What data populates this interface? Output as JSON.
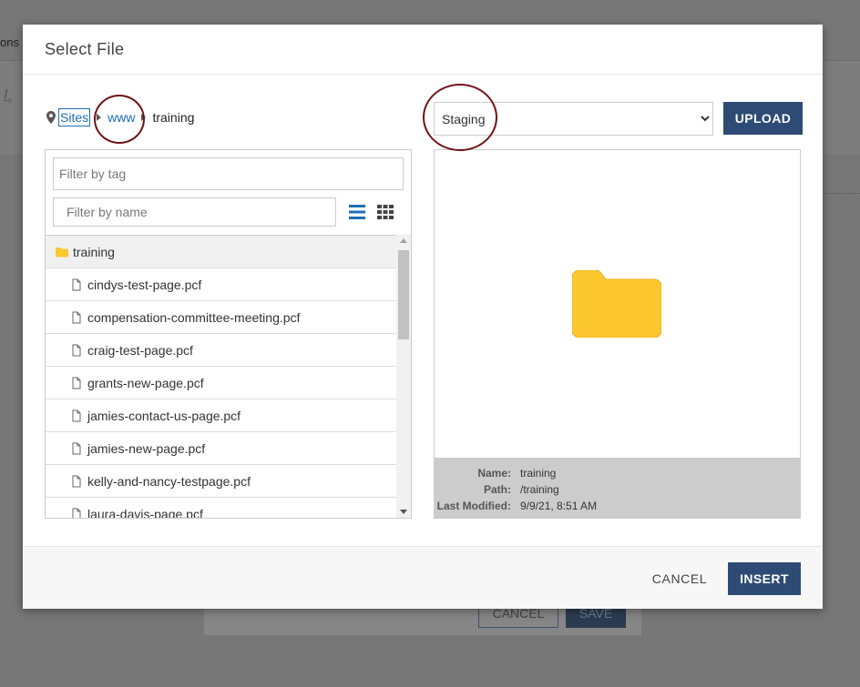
{
  "background": {
    "partial_text": "ons",
    "format_icon": "clear-formatting-icon",
    "dialog_cancel_label": "CANCEL",
    "dialog_save_label": "SAVE"
  },
  "modal": {
    "title": "Select File",
    "breadcrumb": {
      "icon": "map-marker-icon",
      "items": [
        {
          "label": "Sites"
        },
        {
          "label": "www"
        },
        {
          "label": "training"
        }
      ]
    },
    "filters": {
      "tag_placeholder": "Filter by tag",
      "name_placeholder": "Filter by name"
    },
    "view_toggles": [
      "list-view-icon",
      "grid-view-icon"
    ],
    "file_list": [
      {
        "type": "folder",
        "name": "training"
      },
      {
        "type": "file",
        "name": "cindys-test-page.pcf"
      },
      {
        "type": "file",
        "name": "compensation-committee-meeting.pcf"
      },
      {
        "type": "file",
        "name": "craig-test-page.pcf"
      },
      {
        "type": "file",
        "name": "grants-new-page.pcf"
      },
      {
        "type": "file",
        "name": "jamies-contact-us-page.pcf"
      },
      {
        "type": "file",
        "name": "jamies-new-page.pcf"
      },
      {
        "type": "file",
        "name": "kelly-and-nancy-testpage.pcf"
      },
      {
        "type": "file",
        "name": "laura-davis-page.pcf"
      }
    ],
    "environment": {
      "selected": "Staging"
    },
    "upload_label": "UPLOAD",
    "preview": {
      "icon": "folder-icon",
      "name_label": "Name:",
      "name_value": "training",
      "path_label": "Path:",
      "path_value": "/training",
      "modified_label": "Last Modified:",
      "modified_value": "9/9/21, 8:51 AM"
    },
    "footer": {
      "cancel_label": "CANCEL",
      "insert_label": "INSERT"
    }
  },
  "colors": {
    "primary_button": "#2d4b74",
    "link": "#1d6fb8",
    "folder": "#fdc82f",
    "annotation": "#6f1216"
  }
}
